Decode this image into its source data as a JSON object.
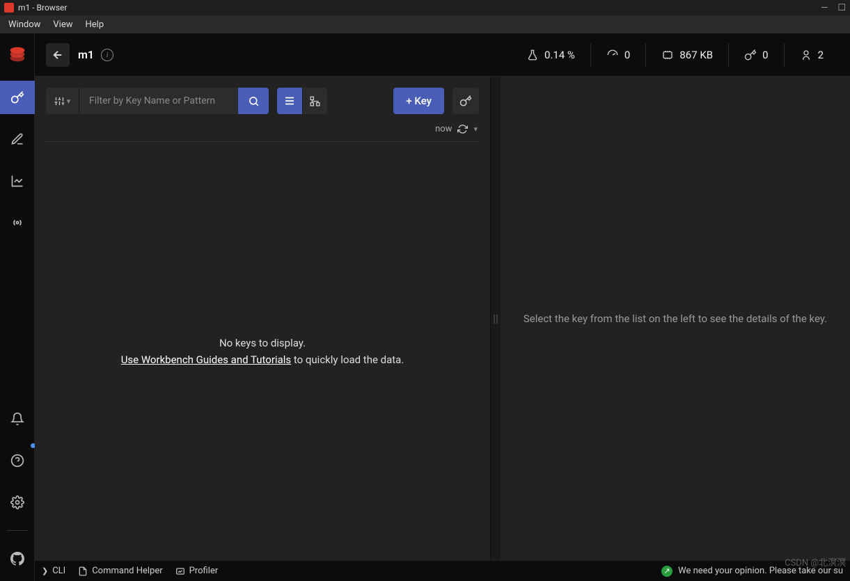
{
  "window": {
    "title": "m1 - Browser"
  },
  "menubar": {
    "window": "Window",
    "view": "View",
    "help": "Help"
  },
  "topbar": {
    "db_name": "m1"
  },
  "stats": {
    "cpu": "0.14 %",
    "throughput": "0",
    "memory": "867 KB",
    "keys": "0",
    "clients": "2"
  },
  "toolbar": {
    "filter_placeholder": "Filter by Key Name or Pattern",
    "add_key_label": "+ Key"
  },
  "refresh": {
    "time_label": "now"
  },
  "empty": {
    "no_keys": "No keys to display.",
    "guides_link": "Use Workbench Guides and Tutorials",
    "guides_suffix": " to quickly load the data."
  },
  "right_panel": {
    "message": "Select the key from the list on the left to see the details of the key."
  },
  "footer": {
    "cli": "CLI",
    "command_helper": "Command Helper",
    "profiler": "Profiler",
    "feedback": "We need your opinion. Please take our su"
  },
  "watermark": "CSDN @北溟溟"
}
